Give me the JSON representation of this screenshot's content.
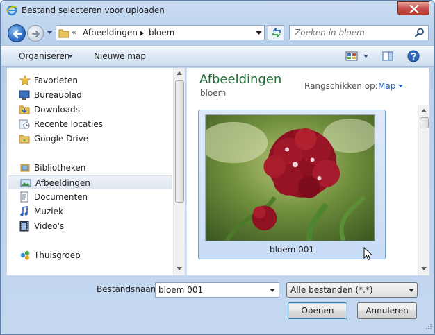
{
  "window": {
    "title": "Bestand selecteren voor uploaden"
  },
  "address": {
    "overflow_chevron": "«",
    "segments": [
      "Afbeeldingen",
      "bloem"
    ]
  },
  "search": {
    "placeholder": "Zoeken in bloem"
  },
  "toolbar": {
    "organise_label": "Organiseren",
    "new_folder_label": "Nieuwe map"
  },
  "nav": {
    "favorites": {
      "label": "Favorieten",
      "items": [
        {
          "label": "Bureaublad",
          "icon": "desktop-icon"
        },
        {
          "label": "Downloads",
          "icon": "downloads-folder-icon"
        },
        {
          "label": "Recente locaties",
          "icon": "recent-places-icon"
        },
        {
          "label": "Google Drive",
          "icon": "google-drive-folder-icon"
        }
      ]
    },
    "libraries": {
      "label": "Bibliotheken",
      "items": [
        {
          "label": "Afbeeldingen",
          "icon": "pictures-icon",
          "selected": true
        },
        {
          "label": "Documenten",
          "icon": "documents-icon"
        },
        {
          "label": "Muziek",
          "icon": "music-icon"
        },
        {
          "label": "Video's",
          "icon": "videos-icon"
        }
      ]
    },
    "homegroup": {
      "label": "Thuisgroep"
    }
  },
  "content": {
    "library_title": "Afbeeldingen",
    "library_subtitle": "bloem",
    "arrange_label": "Rangschikken op:",
    "arrange_value": "Map",
    "files": [
      {
        "name": "bloem 001",
        "selected": true
      }
    ]
  },
  "footer": {
    "filename_label": "Bestandsnaam:",
    "filename_value": "bloem 001",
    "filter_value": "Alle bestanden (*.*)",
    "open_label": "Openen",
    "cancel_label": "Annuleren"
  },
  "colors": {
    "accent_green": "#1e6a34",
    "link_blue": "#1c5fb3",
    "close_red": "#c75050"
  }
}
